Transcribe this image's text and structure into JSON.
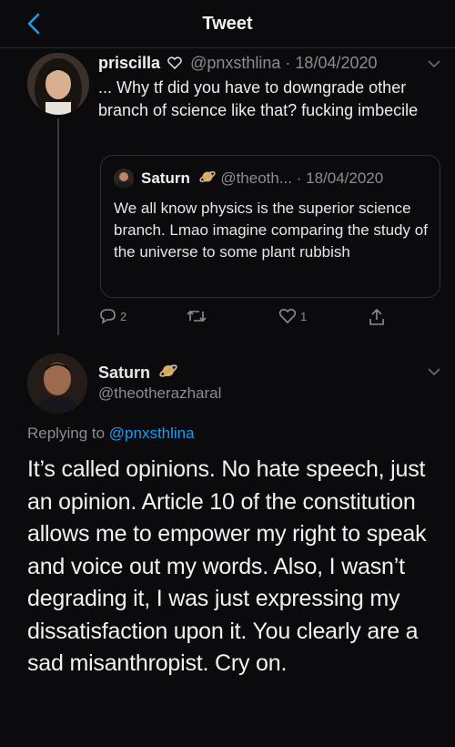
{
  "header": {
    "title": "Tweet"
  },
  "parent": {
    "name": "priscilla",
    "name_icon": "heart-outline-icon",
    "handle": "@pnxsthlina",
    "date": "· 18/04/2020",
    "text": "... Why tf did you have to downgrade other branch of science like that?  fucking imbecile"
  },
  "quoted": {
    "name": "Saturn",
    "handle": "@theoth...",
    "date": "· 18/04/2020",
    "text": "We all know physics is the superior science branch. Lmao imagine comparing the study of the universe to some plant rubbish"
  },
  "actions": {
    "reply_count": "2",
    "retweet_count": "",
    "like_count": "1"
  },
  "main": {
    "name": "Saturn",
    "handle": "@theotherazharal",
    "replying_prefix": "Replying to ",
    "replying_handle": "@pnxsthlina",
    "text": "It’s called opinions. No hate speech, just an opinion. Article 10 of the constitution allows me to empower my right to speak and voice out my words. Also, I wasn’t degrading it, I was just expressing my dissatisfaction upon it. You clearly are a sad misanthropist. Cry on."
  },
  "colors": {
    "background": "#0b0b0d",
    "link": "#1d9bf0",
    "muted": "#8b8b92"
  }
}
